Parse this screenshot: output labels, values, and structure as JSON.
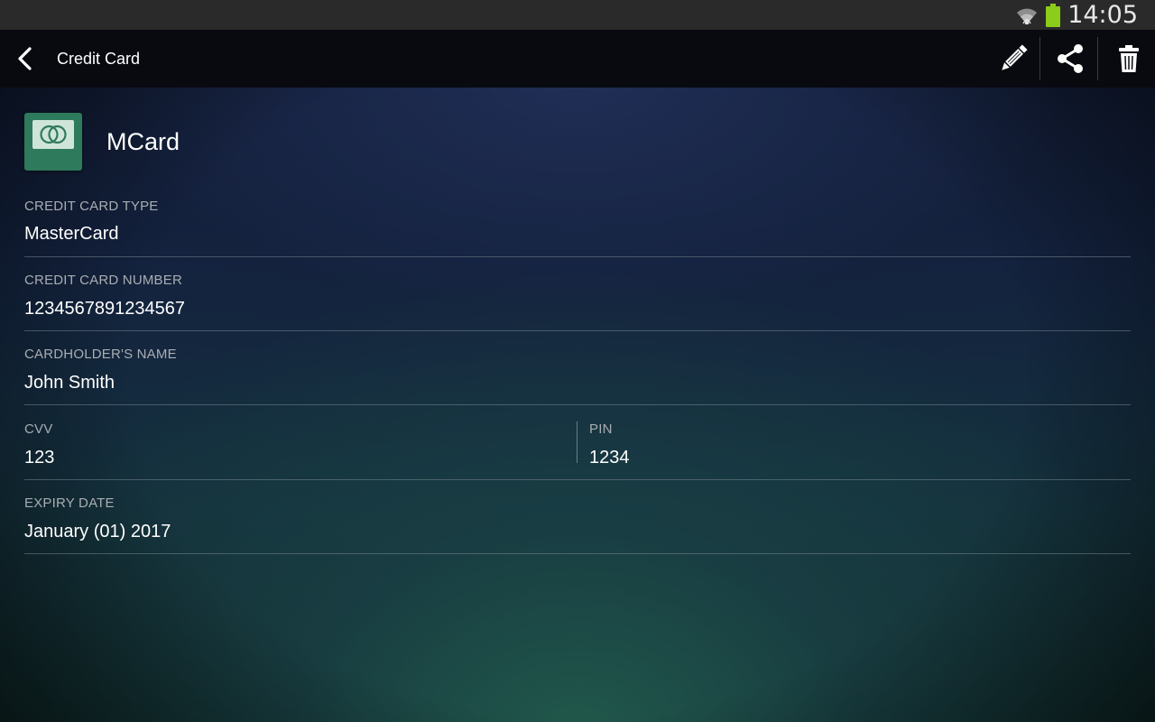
{
  "status_bar": {
    "time": "14:05",
    "icons": [
      "wifi-icon",
      "battery-icon"
    ],
    "battery_color": "#8ccc1a"
  },
  "action_bar": {
    "title": "Credit Card",
    "actions": [
      "edit-icon",
      "share-icon",
      "delete-icon"
    ]
  },
  "item": {
    "name": "MCard",
    "icon": "mastercard-icon",
    "icon_color": "#2e7a5c"
  },
  "fields": {
    "card_type": {
      "label": "CREDIT CARD TYPE",
      "value": "MasterCard"
    },
    "card_number": {
      "label": "CREDIT CARD NUMBER",
      "value": "1234567891234567"
    },
    "cardholder": {
      "label": "CARDHOLDER'S NAME",
      "value": "John Smith"
    },
    "cvv": {
      "label": "CVV",
      "value": "123"
    },
    "pin": {
      "label": "PIN",
      "value": "1234"
    },
    "expiry": {
      "label": "EXPIRY DATE",
      "value": "January (01) 2017"
    }
  }
}
